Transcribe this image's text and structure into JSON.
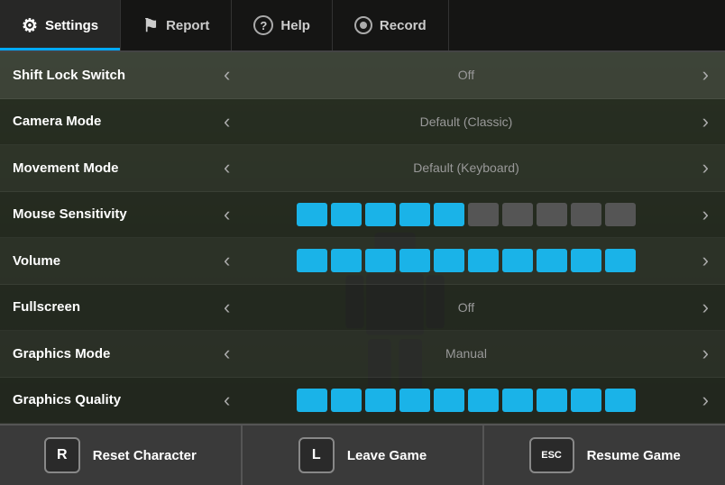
{
  "nav": {
    "tabs": [
      {
        "id": "settings",
        "label": "Settings",
        "icon": "⚙",
        "active": true
      },
      {
        "id": "report",
        "label": "Report",
        "icon": "⚑",
        "active": false
      },
      {
        "id": "help",
        "label": "Help",
        "icon": "?",
        "active": false
      },
      {
        "id": "record",
        "label": "Record",
        "icon": "◎",
        "active": false
      }
    ]
  },
  "settings": {
    "rows": [
      {
        "id": "shift-lock-switch",
        "label": "Shift Lock Switch",
        "type": "toggle",
        "value": "Off",
        "highlighted": true
      },
      {
        "id": "camera-mode",
        "label": "Camera Mode",
        "type": "toggle",
        "value": "Default (Classic)",
        "highlighted": false
      },
      {
        "id": "movement-mode",
        "label": "Movement Mode",
        "type": "toggle",
        "value": "Default (Keyboard)",
        "highlighted": false
      },
      {
        "id": "mouse-sensitivity",
        "label": "Mouse Sensitivity",
        "type": "blocks",
        "active_blocks": 5,
        "total_blocks": 10,
        "highlighted": false
      },
      {
        "id": "volume",
        "label": "Volume",
        "type": "blocks",
        "active_blocks": 10,
        "total_blocks": 10,
        "highlighted": false
      },
      {
        "id": "fullscreen",
        "label": "Fullscreen",
        "type": "toggle",
        "value": "Off",
        "highlighted": false
      },
      {
        "id": "graphics-mode",
        "label": "Graphics Mode",
        "type": "toggle",
        "value": "Manual",
        "highlighted": false
      },
      {
        "id": "graphics-quality",
        "label": "Graphics Quality",
        "type": "blocks",
        "active_blocks": 10,
        "total_blocks": 10,
        "highlighted": false
      }
    ]
  },
  "bottom_buttons": [
    {
      "id": "reset-character",
      "key": "R",
      "label": "Reset Character"
    },
    {
      "id": "leave-game",
      "key": "L",
      "label": "Leave Game"
    },
    {
      "id": "resume-game",
      "key": "ESC",
      "label": "Resume Game"
    }
  ]
}
